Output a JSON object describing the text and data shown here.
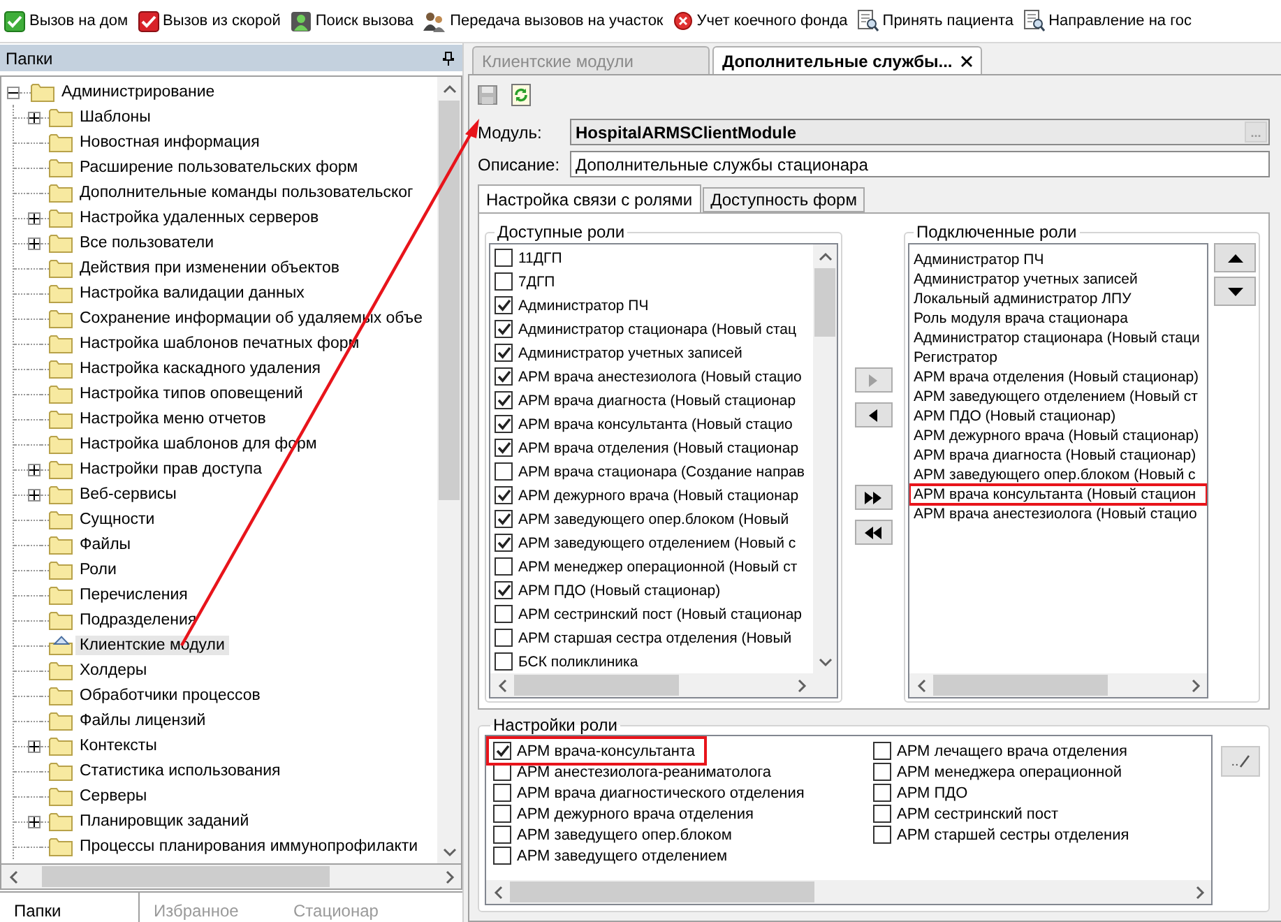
{
  "toolbar": [
    {
      "label": "Вызов на дом"
    },
    {
      "label": "Вызов из скорой"
    },
    {
      "label": "Поиск вызова"
    },
    {
      "label": "Передача вызовов на участок"
    },
    {
      "label": "Учет коечного фонда"
    },
    {
      "label": "Принять пациента"
    },
    {
      "label": "Направление на гос"
    }
  ],
  "left_panel": {
    "title": "Папки",
    "tree": [
      {
        "label": "Администрирование",
        "expanded": true,
        "selected": false,
        "children": [
          {
            "label": "Шаблоны",
            "expanded": false,
            "selected": false
          },
          {
            "label": "Новостная информация",
            "selected": false
          },
          {
            "label": "Расширение пользовательских форм",
            "selected": false
          },
          {
            "label": "Дополнительные команды пользовательског",
            "selected": false
          },
          {
            "label": "Настройка удаленных серверов",
            "expanded": false,
            "selected": false
          },
          {
            "label": "Все пользователи",
            "expanded": false,
            "selected": false
          },
          {
            "label": "Действия при изменении объектов",
            "selected": false
          },
          {
            "label": "Настройка валидации данных",
            "selected": false
          },
          {
            "label": "Сохранение информации об удаляемых объе",
            "selected": false
          },
          {
            "label": "Настройка шаблонов печатных форм",
            "selected": false
          },
          {
            "label": "Настройка каскадного удаления",
            "selected": false
          },
          {
            "label": "Настройка типов оповещений",
            "selected": false
          },
          {
            "label": "Настройка меню отчетов",
            "selected": false
          },
          {
            "label": "Настройка шаблонов для форм",
            "selected": false
          },
          {
            "label": "Настройки прав доступа",
            "expanded": false,
            "selected": false
          },
          {
            "label": "Веб-сервисы",
            "expanded": false,
            "selected": false
          },
          {
            "label": "Сущности",
            "selected": false
          },
          {
            "label": "Файлы",
            "selected": false
          },
          {
            "label": "Роли",
            "selected": false
          },
          {
            "label": "Перечисления",
            "selected": false
          },
          {
            "label": "Подразделения",
            "selected": false
          },
          {
            "label": "Клиентские модули",
            "selected": true
          },
          {
            "label": "Холдеры",
            "selected": false
          },
          {
            "label": "Обработчики процессов",
            "selected": false
          },
          {
            "label": "Файлы лицензий",
            "selected": false
          },
          {
            "label": "Контексты",
            "expanded": false,
            "selected": false
          },
          {
            "label": "Статистика использования",
            "selected": false
          },
          {
            "label": "Серверы",
            "selected": false
          },
          {
            "label": "Планировщик заданий",
            "expanded": false,
            "selected": false
          },
          {
            "label": "Процессы планирования иммунопрофилакти",
            "selected": false
          }
        ]
      }
    ],
    "tabs": [
      {
        "label": "Папки",
        "selected": true
      },
      {
        "label": "Избранное",
        "selected": false
      },
      {
        "label": "Стационар",
        "selected": false
      }
    ]
  },
  "doc_tabs": [
    {
      "label": "Клиентские модули",
      "selected": false,
      "closable": false
    },
    {
      "label": "Дополнительные службы...",
      "selected": true,
      "closable": true
    }
  ],
  "module": {
    "label": "Модуль:",
    "value": "HospitalARMSClientModule",
    "browse": "..."
  },
  "description": {
    "label": "Описание:",
    "value": "Дополнительные службы стационара"
  },
  "inner_tabs": [
    {
      "label": "Настройка связи с ролями",
      "selected": true
    },
    {
      "label": "Доступность форм",
      "selected": false
    }
  ],
  "available_roles": {
    "title": "Доступные роли",
    "items": [
      {
        "label": "11ДГП",
        "checked": false
      },
      {
        "label": "7ДГП",
        "checked": false
      },
      {
        "label": "Администратор ПЧ",
        "checked": true
      },
      {
        "label": "Администратор стационара (Новый стац",
        "checked": true
      },
      {
        "label": "Администратор учетных записей",
        "checked": true
      },
      {
        "label": "АРМ врача анестезиолога (Новый стацио",
        "checked": true
      },
      {
        "label": "АРМ врача диагноста (Новый стационар",
        "checked": true
      },
      {
        "label": "АРМ врача консультанта (Новый стацио",
        "checked": true
      },
      {
        "label": "АРМ врача отделения (Новый стационар",
        "checked": true
      },
      {
        "label": "АРМ врача стационара (Создание направ",
        "checked": false
      },
      {
        "label": "АРМ дежурного врача (Новый стационар",
        "checked": true
      },
      {
        "label": "АРМ заведующего опер.блоком (Новый",
        "checked": true
      },
      {
        "label": "АРМ заведующего отделением (Новый с",
        "checked": true
      },
      {
        "label": "АРМ менеджер операционной (Новый ст",
        "checked": false
      },
      {
        "label": "АРМ ПДО (Новый стационар)",
        "checked": true
      },
      {
        "label": "АРМ сестринский пост (Новый стационар",
        "checked": false
      },
      {
        "label": "АРМ старшая сестра отделения (Новый",
        "checked": false
      },
      {
        "label": "БСК поликлиника",
        "checked": false
      }
    ]
  },
  "move_buttons": [
    {
      "kind": "add",
      "disabled": true
    },
    {
      "kind": "remove",
      "disabled": false
    },
    {
      "kind": "add_all",
      "disabled": false
    },
    {
      "kind": "remove_all",
      "disabled": false
    }
  ],
  "connected_roles": {
    "title": "Подключенные роли",
    "items": [
      {
        "label": "Администратор ПЧ",
        "highlighted": false
      },
      {
        "label": "Администратор учетных записей",
        "highlighted": false
      },
      {
        "label": "Локальный администратор ЛПУ",
        "highlighted": false
      },
      {
        "label": "Роль модуля врача стационара",
        "highlighted": false
      },
      {
        "label": "Администратор стационара (Новый стаци",
        "highlighted": false
      },
      {
        "label": "Регистратор",
        "highlighted": false
      },
      {
        "label": "АРМ врача отделения (Новый стационар)",
        "highlighted": false
      },
      {
        "label": "АРМ заведующего отделением (Новый ст",
        "highlighted": false
      },
      {
        "label": "АРМ ПДО (Новый стационар)",
        "highlighted": false
      },
      {
        "label": "АРМ дежурного врача (Новый стационар)",
        "highlighted": false
      },
      {
        "label": "АРМ врача диагноста (Новый стационар)",
        "highlighted": false
      },
      {
        "label": "АРМ заведующего опер.блоком (Новый с",
        "highlighted": false
      },
      {
        "label": "АРМ врача консультанта (Новый стацион",
        "highlighted": true
      },
      {
        "label": "АРМ врача анестезиолога (Новый стацио",
        "highlighted": false
      }
    ]
  },
  "order_buttons": [
    {
      "kind": "up"
    },
    {
      "kind": "down"
    }
  ],
  "role_settings": {
    "title": "Настройки роли",
    "edit_button": "..",
    "columns": [
      [
        {
          "label": "АРМ врача-консультанта",
          "checked": true,
          "highlighted": true
        },
        {
          "label": "АРМ анестезиолога-реаниматолога",
          "checked": false,
          "highlighted": false
        },
        {
          "label": "АРМ врача диагностического отделения",
          "checked": false,
          "highlighted": false
        },
        {
          "label": "АРМ дежурного врача отделения",
          "checked": false,
          "highlighted": false
        },
        {
          "label": "АРМ заведущего опер.блоком",
          "checked": false,
          "highlighted": false
        },
        {
          "label": "АРМ заведущего отделением",
          "checked": false,
          "highlighted": false
        }
      ],
      [
        {
          "label": "АРМ лечащего врача отделения",
          "checked": false,
          "highlighted": false
        },
        {
          "label": "АРМ менеджера операционной",
          "checked": false,
          "highlighted": false
        },
        {
          "label": "АРМ ПДО",
          "checked": false,
          "highlighted": false
        },
        {
          "label": "АРМ сестринский пост",
          "checked": false,
          "highlighted": false
        },
        {
          "label": "АРМ старшей сестры отделения",
          "checked": false,
          "highlighted": false
        }
      ]
    ]
  }
}
